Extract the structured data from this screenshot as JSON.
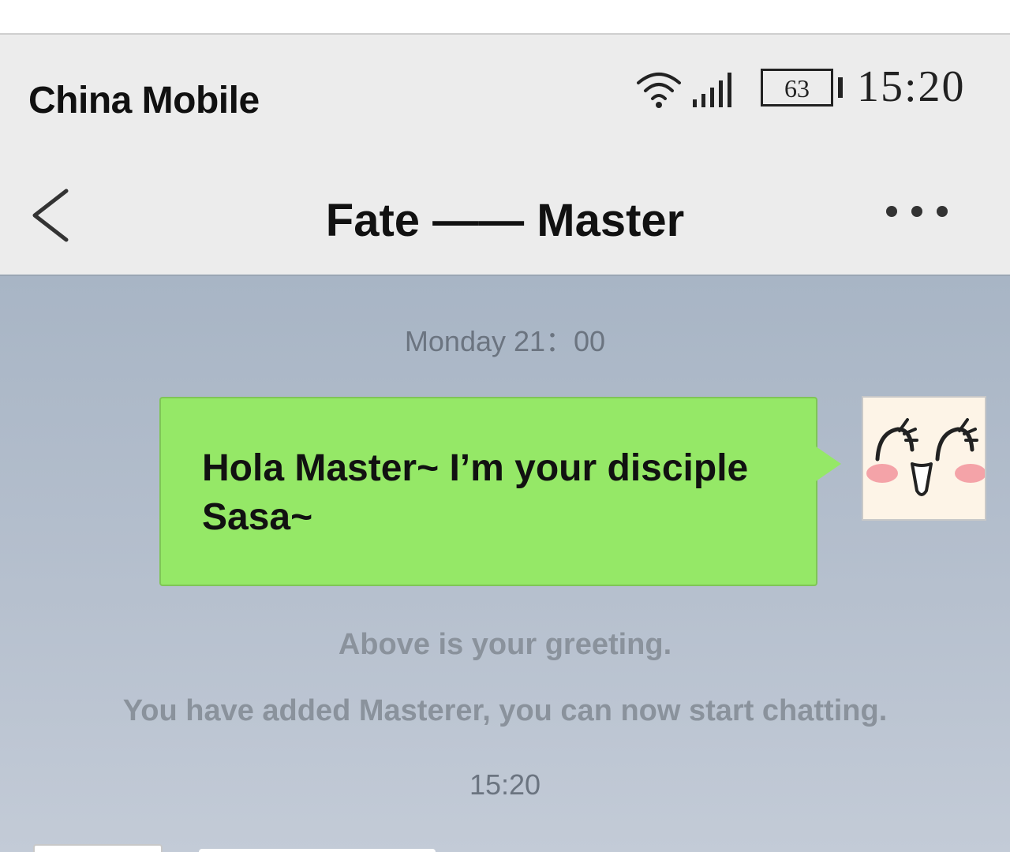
{
  "status_bar": {
    "carrier": "China Mobile",
    "battery_level": "63",
    "time": "15:20"
  },
  "nav": {
    "title": "Fate —— Master"
  },
  "chat": {
    "timestamp_1": "Monday 21：00",
    "message": "Hola Master~ I’m your disciple Sasa~",
    "system_msg_1": "Above is your greeting.",
    "system_msg_2": "You have added Masterer, you can now start chatting.",
    "timestamp_2": "15:20"
  },
  "icons": {
    "wifi": "wifi-icon",
    "signal": "signal-icon",
    "battery": "battery-icon",
    "back": "back-icon",
    "more": "more-icon",
    "avatar": "smiley-face-avatar"
  },
  "colors": {
    "bubble": "#95e867",
    "chat_background": "#a8b5c5",
    "bar_background": "#ececec",
    "system_text": "#8a929c",
    "blush": "#f4a3a8"
  }
}
